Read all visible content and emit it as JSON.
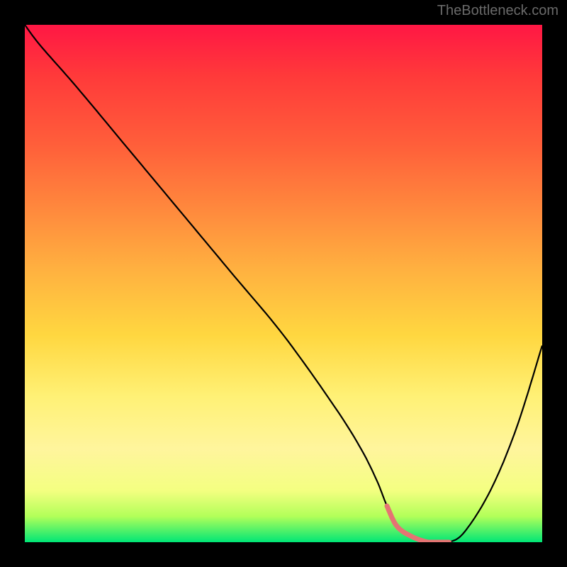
{
  "attribution": "TheBottleneck.com",
  "chart_data": {
    "type": "line",
    "title": "",
    "xlabel": "",
    "ylabel": "",
    "xlim": [
      0,
      100
    ],
    "ylim": [
      0,
      100
    ],
    "series": [
      {
        "name": "bottleneck-curve",
        "x": [
          0,
          3,
          10,
          20,
          30,
          40,
          50,
          60,
          65,
          68,
          70,
          72,
          75,
          78,
          80,
          82,
          85,
          90,
          95,
          100
        ],
        "values": [
          100,
          96,
          88,
          76,
          64,
          52,
          40,
          26,
          18,
          12,
          7,
          3,
          1,
          0,
          0,
          0,
          2,
          10,
          22,
          38
        ]
      }
    ],
    "valley_range_x": [
      70,
      82
    ],
    "valley_marker_color": "#e57373",
    "gradient_colors": {
      "top": "#ff1744",
      "mid": "#ffd740",
      "bottom": "#00e676"
    },
    "background": "#000000"
  }
}
